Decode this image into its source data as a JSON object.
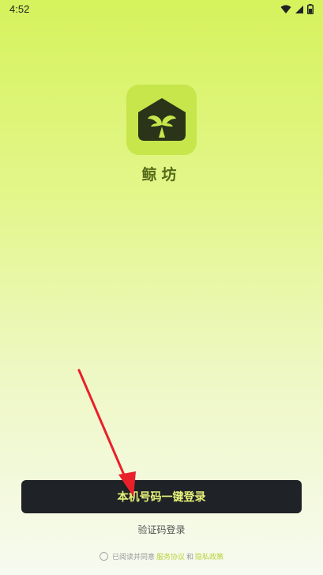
{
  "status_bar": {
    "time": "4:52"
  },
  "app": {
    "name": "鲸坊",
    "logo_icon": "whale-tail-house-icon"
  },
  "actions": {
    "one_click_login": "本机号码一键登录",
    "sms_login": "验证码登录"
  },
  "agreement": {
    "prefix": "已阅读并同意",
    "terms": "服务协议",
    "conj": "和",
    "privacy": "隐私政策"
  },
  "colors": {
    "accent": "#c6e64b",
    "button_bg": "#1f2226",
    "button_text": "#e8f27a",
    "link": "#b8d23d"
  }
}
